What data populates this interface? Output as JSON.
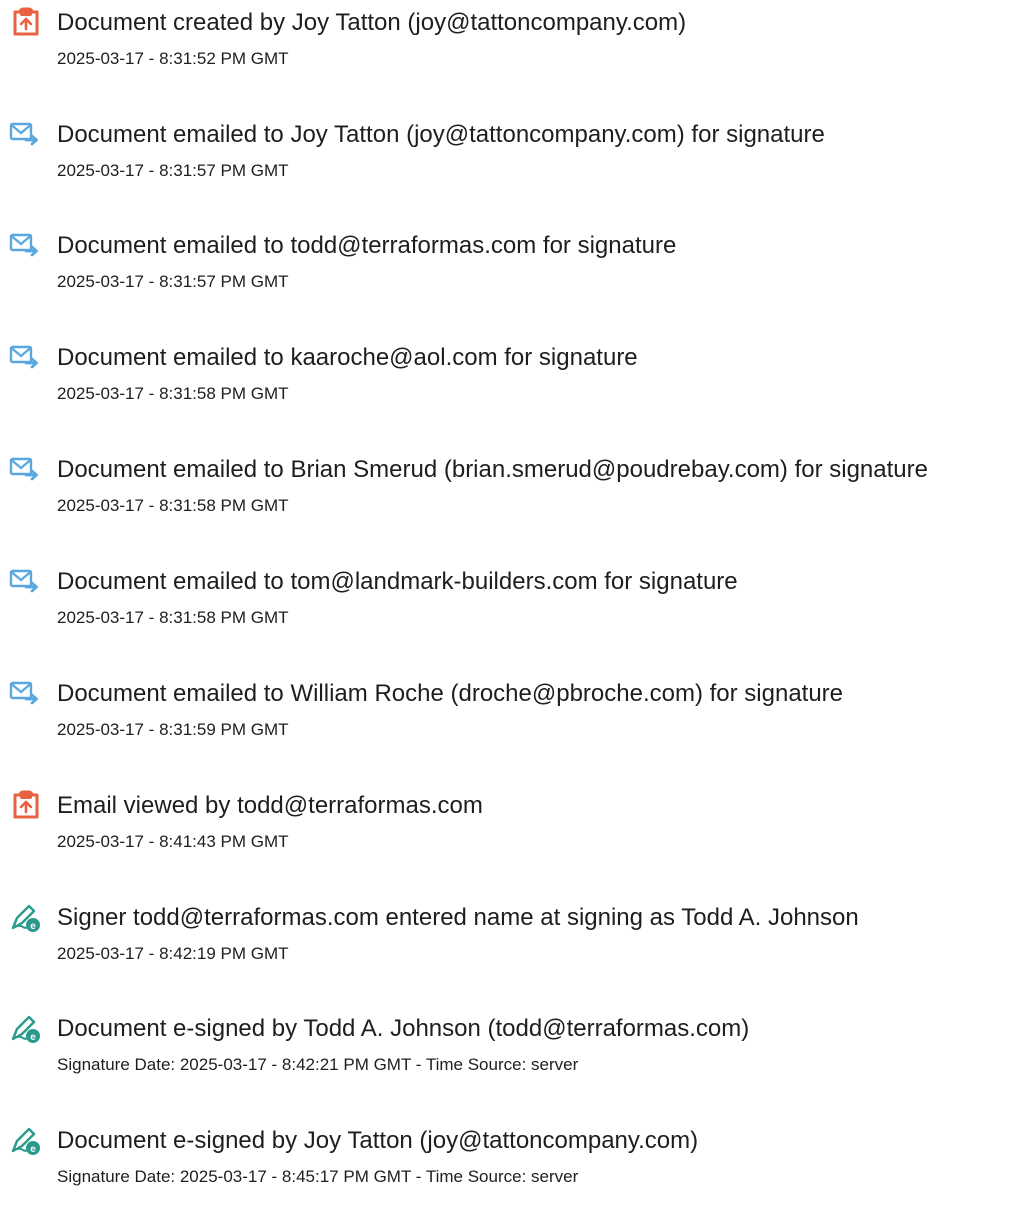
{
  "events": [
    {
      "icon": "document-created-icon",
      "title": "Document created by Joy Tatton (joy@tattoncompany.com)",
      "detail": "2025-03-17 - 8:31:52 PM GMT"
    },
    {
      "icon": "email-sent-icon",
      "title": "Document emailed to Joy Tatton (joy@tattoncompany.com) for signature",
      "detail": "2025-03-17 - 8:31:57 PM GMT"
    },
    {
      "icon": "email-sent-icon",
      "title": "Document emailed to todd@terraformas.com for signature",
      "detail": "2025-03-17 - 8:31:57 PM GMT"
    },
    {
      "icon": "email-sent-icon",
      "title": "Document emailed to kaaroche@aol.com for signature",
      "detail": "2025-03-17 - 8:31:58 PM GMT"
    },
    {
      "icon": "email-sent-icon",
      "title": "Document emailed to Brian Smerud (brian.smerud@poudrebay.com) for signature",
      "detail": "2025-03-17 - 8:31:58 PM GMT"
    },
    {
      "icon": "email-sent-icon",
      "title": "Document emailed to tom@landmark-builders.com for signature",
      "detail": "2025-03-17 - 8:31:58 PM GMT"
    },
    {
      "icon": "email-sent-icon",
      "title": "Document emailed to William Roche (droche@pbroche.com) for signature",
      "detail": "2025-03-17 - 8:31:59 PM GMT"
    },
    {
      "icon": "document-created-icon",
      "title": "Email viewed by todd@terraformas.com",
      "detail": "2025-03-17 - 8:41:43 PM GMT"
    },
    {
      "icon": "e-sign-pen-icon",
      "title": "Signer todd@terraformas.com entered name at signing as Todd A. Johnson",
      "detail": "2025-03-17 - 8:42:19 PM GMT"
    },
    {
      "icon": "e-sign-pen-icon",
      "title": "Document e-signed by Todd A. Johnson (todd@terraformas.com)",
      "detail": "Signature Date: 2025-03-17 - 8:42:21 PM GMT - Time Source: server"
    },
    {
      "icon": "e-sign-pen-icon",
      "title": "Document e-signed by Joy Tatton (joy@tattoncompany.com)",
      "detail": "Signature Date: 2025-03-17 - 8:45:17 PM GMT - Time Source: server"
    }
  ],
  "colors": {
    "document_icon": "#e8623f",
    "email_icon": "#5aa7e0",
    "sign_icon": "#2a9a8c",
    "text": "#1e1e1e"
  }
}
